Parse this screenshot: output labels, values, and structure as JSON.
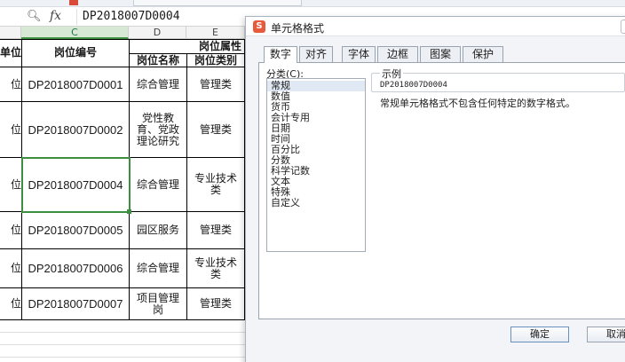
{
  "formula_bar": {
    "zoom_icon": "zoom-icon",
    "fx": "fx",
    "value": "DP2018007D0004"
  },
  "columns": {
    "c": "C",
    "d": "D",
    "e": "E"
  },
  "table": {
    "header_col_a": "单位",
    "header_code": "岗位编号",
    "header_group": "岗位属性",
    "header_name": "岗位名称",
    "header_type": "岗位类别",
    "rows": [
      {
        "a": "位",
        "code": "DP2018007D0001",
        "name": "综合管理",
        "type": "管理类"
      },
      {
        "a": "位",
        "code": "DP2018007D0002",
        "name": "党性教育、党政理论研究",
        "type": "管理类"
      },
      {
        "a": "位",
        "code": "DP2018007D0004",
        "name": "综合管理",
        "type": "专业技术类"
      },
      {
        "a": "位",
        "code": "DP2018007D0005",
        "name": "园区服务",
        "type": "管理类"
      },
      {
        "a": "位",
        "code": "DP2018007D0006",
        "name": "综合管理",
        "type": "专业技术类"
      },
      {
        "a": "位",
        "code": "DP2018007D0007",
        "name": "项目管理岗",
        "type": "管理类"
      }
    ]
  },
  "dialog": {
    "logo": "S",
    "title": "单元格格式",
    "tabs": [
      "数字",
      "对齐",
      "字体",
      "边框",
      "图案",
      "保护"
    ],
    "category_label": "分类(C):",
    "categories": [
      "常规",
      "数值",
      "货币",
      "会计专用",
      "日期",
      "时间",
      "百分比",
      "分数",
      "科学记数",
      "文本",
      "特殊",
      "自定义"
    ],
    "sample_label": "示例",
    "sample_value": "DP2018007D0004",
    "description": "常规单元格格式不包含任何特定的数字格式。",
    "ok": "确定",
    "cancel": "取消"
  }
}
